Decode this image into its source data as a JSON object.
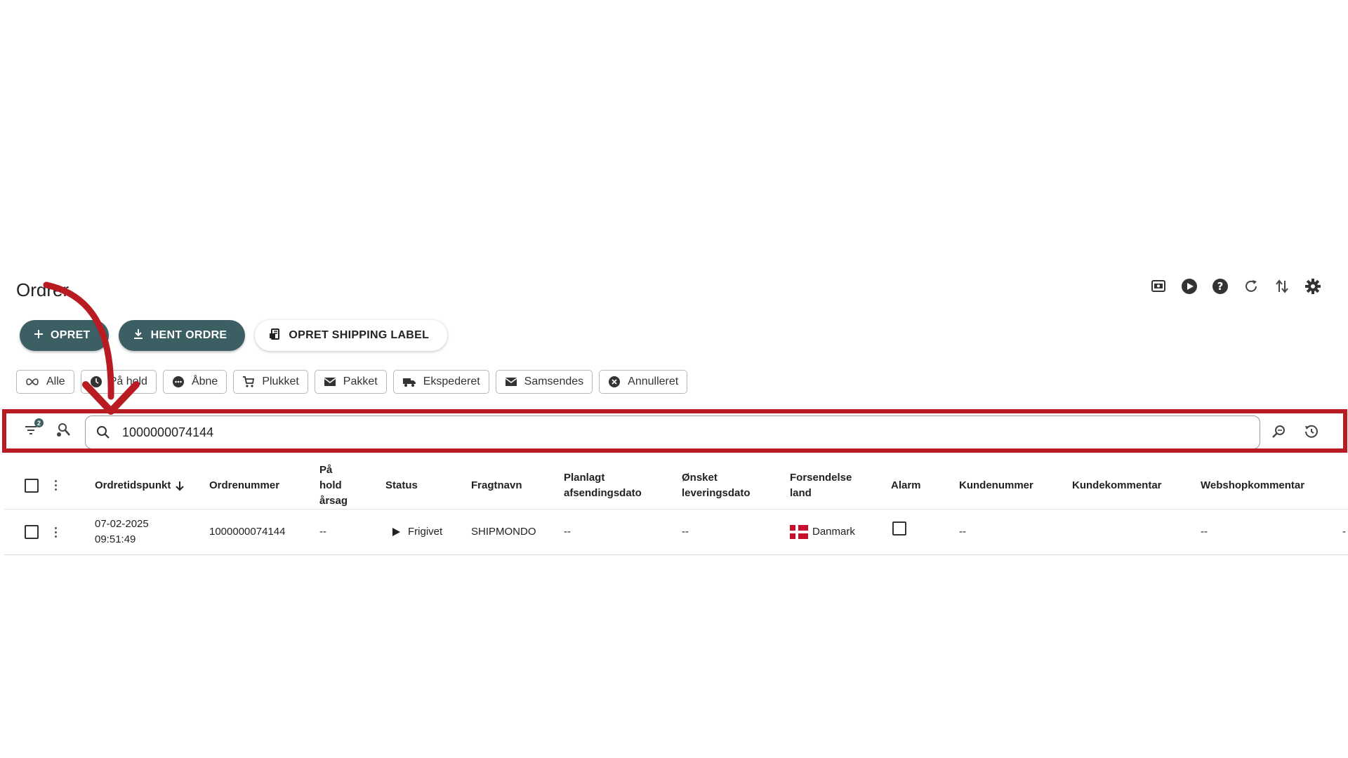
{
  "page": {
    "title": "Ordrer"
  },
  "top_icons": [
    "screen-icon",
    "play-icon",
    "help-icon",
    "refresh-icon",
    "sort-arrows-icon",
    "settings-icon"
  ],
  "actions": {
    "create": "OPRET",
    "fetch": "HENT ORDRE",
    "shipping_label": "OPRET SHIPPING LABEL"
  },
  "chips": {
    "all": "Alle",
    "on_hold": "På hold",
    "open": "Åbne",
    "picked": "Plukket",
    "packed": "Pakket",
    "shipped": "Ekspederet",
    "ship_together": "Samsendes",
    "cancelled": "Annulleret"
  },
  "search": {
    "filter_count": "2",
    "value": "1000000074144"
  },
  "table": {
    "headers": {
      "order_time": "Ordretidspunkt",
      "order_number": "Ordrenummer",
      "hold_reason_1": "På",
      "hold_reason_2": "hold",
      "hold_reason_3": "årsag",
      "status": "Status",
      "carrier": "Fragtnavn",
      "planned_1": "Planlagt",
      "planned_2": "afsendingsdato",
      "desired_1": "Ønsket",
      "desired_2": "leveringsdato",
      "country_1": "Forsendelse",
      "country_2": "land",
      "alarm": "Alarm",
      "customer_no": "Kundenummer",
      "customer_comment": "Kundekommentar",
      "webshop_comment": "Webshopkommentar"
    },
    "row": {
      "date": "07-02-2025",
      "time": "09:51:49",
      "order_number": "1000000074144",
      "hold_reason": "--",
      "status": "Frigivet",
      "carrier": "SHIPMONDO",
      "planned": "--",
      "desired": "--",
      "country": "Danmark",
      "customer_no": "--",
      "customer_comment": "",
      "webshop_comment": "--",
      "extra": "-"
    }
  },
  "colors": {
    "primary": "#3b5f63",
    "highlight": "#b81c22",
    "flag_red": "#c8102e"
  }
}
